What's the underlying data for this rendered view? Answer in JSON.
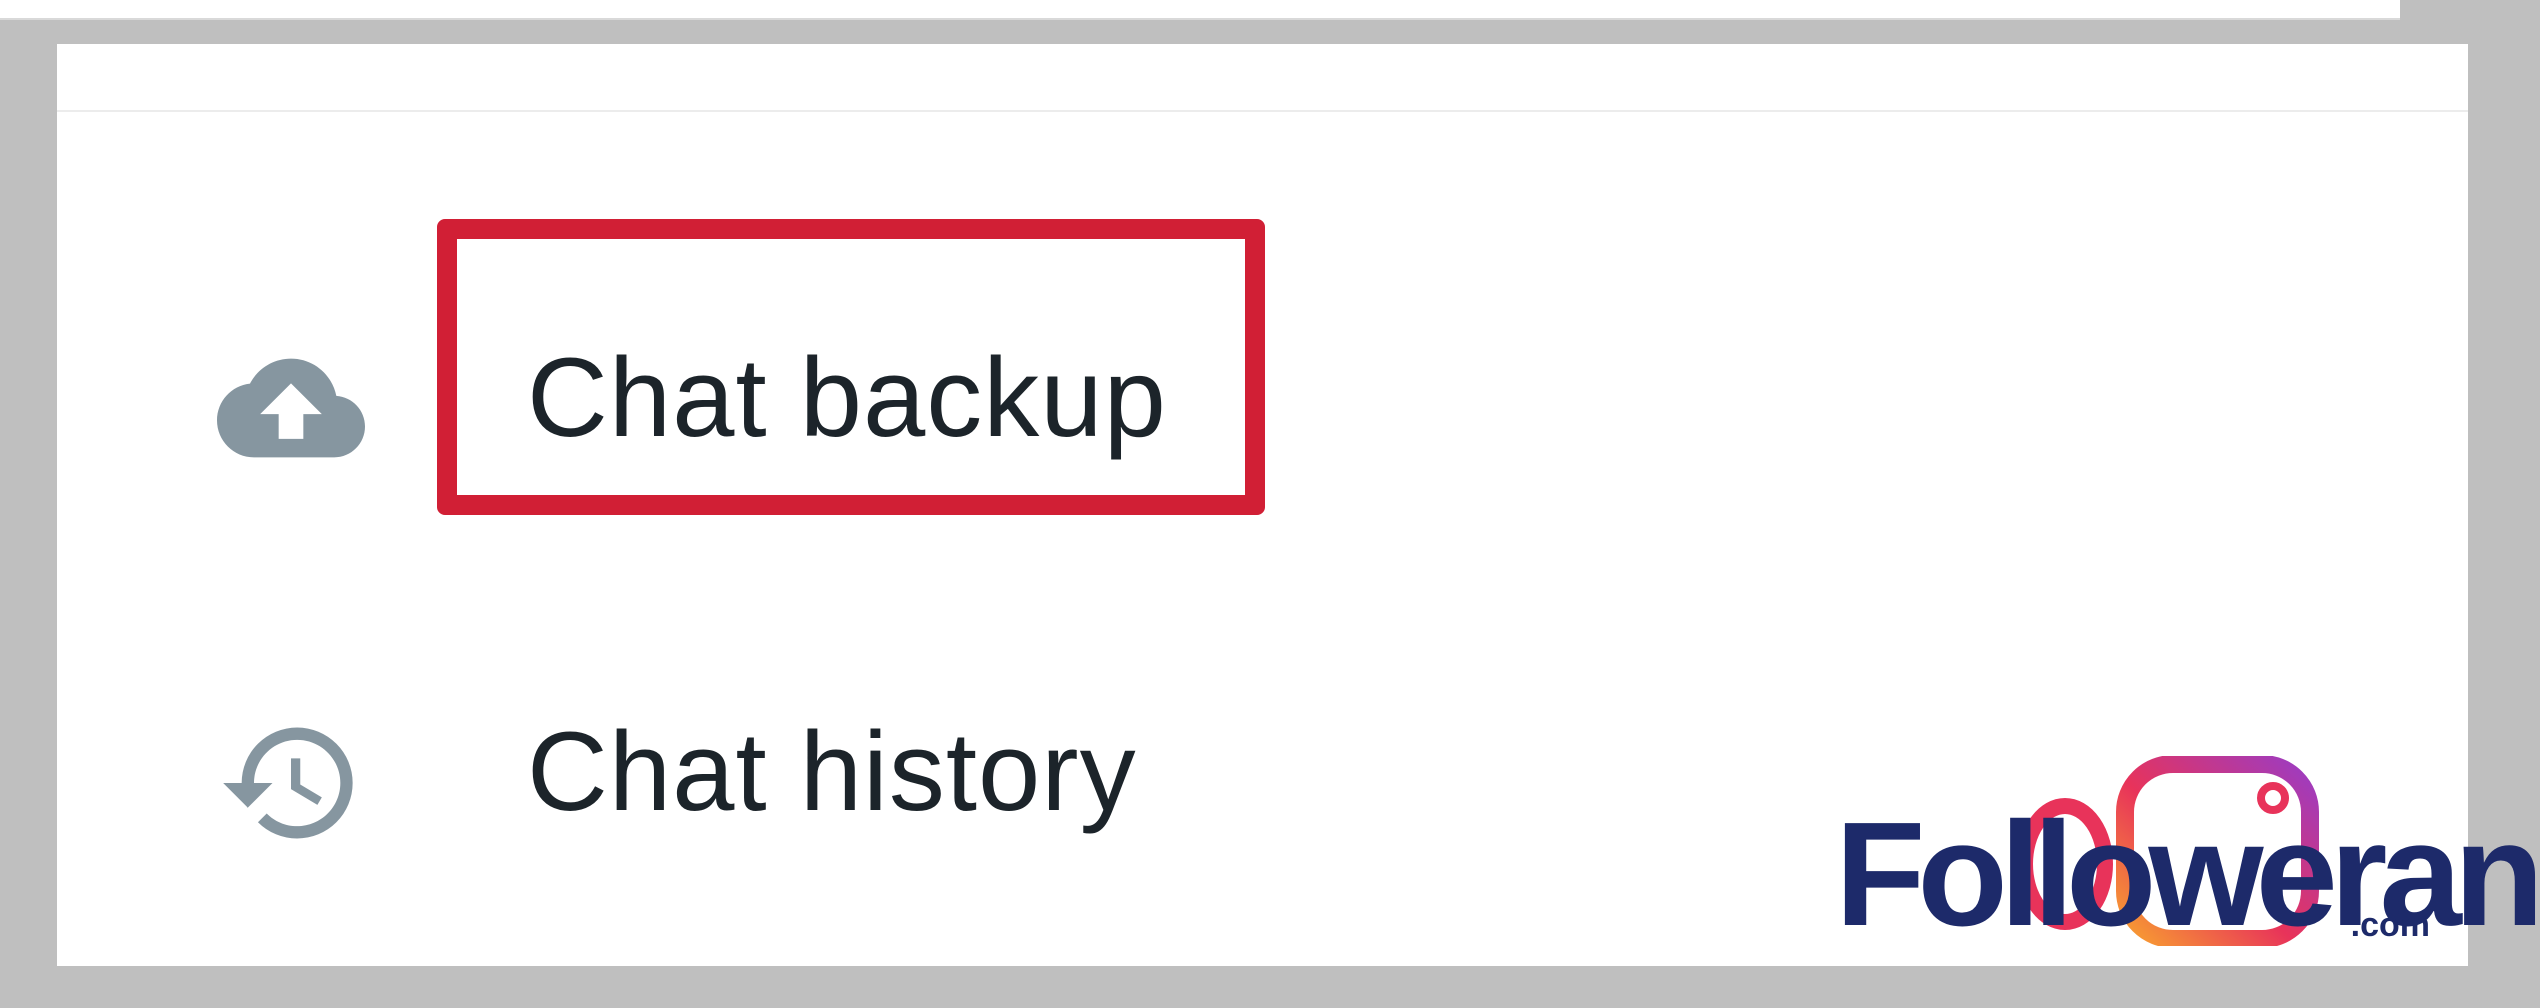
{
  "settings_list": {
    "items": [
      {
        "label": "Chat backup",
        "icon": "cloud-upload-icon"
      },
      {
        "label": "Chat history",
        "icon": "history-icon"
      }
    ]
  },
  "highlight": {
    "target": "Chat backup",
    "color": "#d11f35"
  },
  "watermark": {
    "brand": "Followeran",
    "tld": ".com"
  },
  "colors": {
    "background": "#bfbfbf",
    "panel": "#ffffff",
    "text": "#1c242a",
    "icon": "#8696a0",
    "brand": "#1d2a6a"
  }
}
